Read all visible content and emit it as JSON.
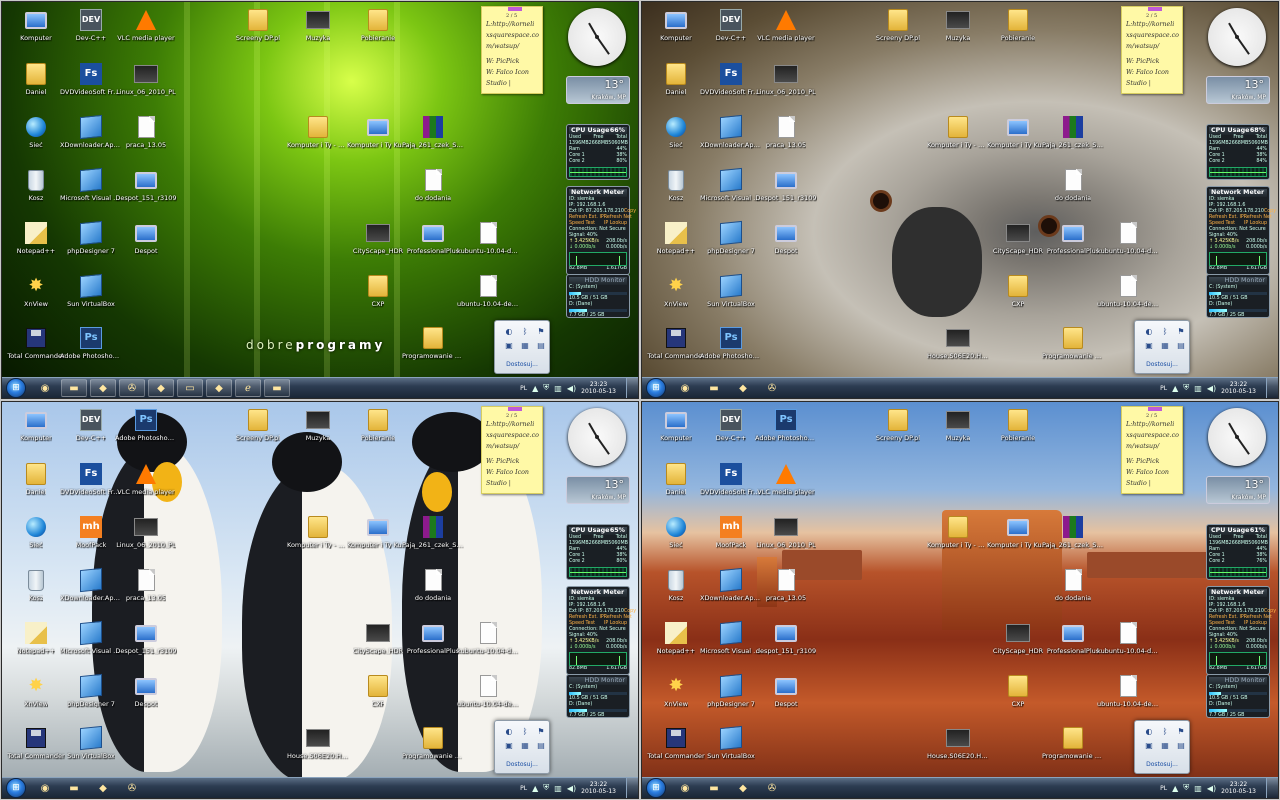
{
  "desktops": [
    {
      "wallpaper": "green",
      "clock_time": "23:23",
      "brand": [
        "dobre",
        "programy"
      ],
      "icons": [
        {
          "label": "Komputer",
          "kind": "pc"
        },
        {
          "label": "Dev-C++",
          "kind": "dev"
        },
        {
          "label": "VLC media player",
          "kind": "vlc"
        },
        {
          "label": "Screeny DP.pl",
          "kind": "folder"
        },
        {
          "label": "Muzyka",
          "kind": "thumb"
        },
        {
          "label": "Pobieranie",
          "kind": "folder"
        },
        {
          "label": "Daniel",
          "kind": "folder"
        },
        {
          "label": "DVDVideoSoft Free Studio",
          "kind": "fs"
        },
        {
          "label": "Linux_06_2010_PL",
          "kind": "thumb"
        },
        {
          "label": "Sieć",
          "kind": "globe"
        },
        {
          "label": "XDownloader.App...",
          "kind": "box"
        },
        {
          "label": "praca_13.05",
          "kind": "doc"
        },
        {
          "label": "Komputer i Ty - Multimedialny Ku...",
          "kind": "folder"
        },
        {
          "label": "Komputer i Ty Kurs PHP",
          "kind": "pc"
        },
        {
          "label": "Pają_261_czek_S_4_...",
          "kind": "rar"
        },
        {
          "label": "Kosz",
          "kind": "bin"
        },
        {
          "label": "Microsoft Visual C++ 2010 Express",
          "kind": "box"
        },
        {
          "label": "Despot_151_r3109",
          "kind": "pc"
        },
        {
          "label": "do dodania",
          "kind": "doc"
        },
        {
          "label": "Notepad++",
          "kind": "pencil"
        },
        {
          "label": "phpDesigner 7",
          "kind": "box"
        },
        {
          "label": "Despot",
          "kind": "pc"
        },
        {
          "label": "CityScape_HDR",
          "kind": "thumb"
        },
        {
          "label": "ProfessionalPlus",
          "kind": "pc"
        },
        {
          "label": "kubuntu-10.04-des...",
          "kind": "doc"
        },
        {
          "label": "XnView",
          "kind": "star"
        },
        {
          "label": "Sun VirtualBox",
          "kind": "box"
        },
        {
          "label": "CXP",
          "kind": "folder"
        },
        {
          "label": "ubuntu-10.04-desk...",
          "kind": "doc"
        },
        {
          "label": "Total Commander",
          "kind": "floppy"
        },
        {
          "label": "Adobe Photoshop CS4 (64 Bit)",
          "kind": "ps"
        },
        {
          "label": "Programowanie C++",
          "kind": "folder"
        }
      ],
      "cpu": {
        "title": "CPU Usage",
        "percent": "66%",
        "used": "1396MB",
        "free": "2668MB",
        "total": "5060MB",
        "ram": "44%",
        "core1": "38%",
        "core2": "80%"
      },
      "date": "2010-05-13"
    },
    {
      "wallpaper": "koala",
      "clock_time": "23:22",
      "icons": [
        {
          "label": "Komputer",
          "kind": "pc"
        },
        {
          "label": "Dev-C++",
          "kind": "dev"
        },
        {
          "label": "VLC media player",
          "kind": "vlc"
        },
        {
          "label": "Screeny DP.pl",
          "kind": "folder"
        },
        {
          "label": "Muzyka",
          "kind": "thumb"
        },
        {
          "label": "Pobieranie",
          "kind": "folder"
        },
        {
          "label": "Daniel",
          "kind": "folder"
        },
        {
          "label": "DVDVideoSoft Free Studio",
          "kind": "fs"
        },
        {
          "label": "Linux_06_2010_PL",
          "kind": "thumb"
        },
        {
          "label": "Sieć",
          "kind": "globe"
        },
        {
          "label": "XDownloader.App...",
          "kind": "box"
        },
        {
          "label": "praca_13.05",
          "kind": "doc"
        },
        {
          "label": "Komputer i Ty - Multimedialny Ku...",
          "kind": "folder"
        },
        {
          "label": "Komputer i Ty Kurs PHP",
          "kind": "pc"
        },
        {
          "label": "Pają_261_czek_S_4_...",
          "kind": "rar"
        },
        {
          "label": "Kosz",
          "kind": "bin"
        },
        {
          "label": "Microsoft Visual C++ 2010 Express",
          "kind": "box"
        },
        {
          "label": "Despot_151_r3109",
          "kind": "pc"
        },
        {
          "label": "do dodania",
          "kind": "doc"
        },
        {
          "label": "Notepad++",
          "kind": "pencil"
        },
        {
          "label": "phpDesigner 7",
          "kind": "box"
        },
        {
          "label": "Despot",
          "kind": "pc"
        },
        {
          "label": "CityScape_HDR",
          "kind": "thumb"
        },
        {
          "label": "ProfessionalPlus",
          "kind": "pc"
        },
        {
          "label": "kubuntu-10.04-des...",
          "kind": "doc"
        },
        {
          "label": "XnView",
          "kind": "star"
        },
        {
          "label": "Sun VirtualBox",
          "kind": "box"
        },
        {
          "label": "CXP",
          "kind": "folder"
        },
        {
          "label": "ubuntu-10.04-desk...",
          "kind": "doc"
        },
        {
          "label": "Total Commander",
          "kind": "floppy"
        },
        {
          "label": "Adobe Photoshop CS4 (64 Bit)",
          "kind": "ps"
        },
        {
          "label": "House.S06E20.HDT...",
          "kind": "thumb"
        },
        {
          "label": "Programowanie C++",
          "kind": "folder"
        }
      ],
      "cpu": {
        "title": "CPU Usage",
        "percent": "68%",
        "used": "1396MB",
        "free": "2668MB",
        "total": "5060MB",
        "ram": "44%",
        "core1": "38%",
        "core2": "84%"
      },
      "date": "2010-05-13"
    },
    {
      "wallpaper": "penguins",
      "clock_time": "23:22",
      "icons": [
        {
          "label": "Komputer",
          "kind": "pc"
        },
        {
          "label": "Dev-C++",
          "kind": "dev"
        },
        {
          "label": "Adobe Photoshop CS4 (64 Bit)",
          "kind": "ps"
        },
        {
          "label": "Screeny DP.pl",
          "kind": "folder"
        },
        {
          "label": "Muzyka",
          "kind": "thumb"
        },
        {
          "label": "Pobieranie",
          "kind": "folder"
        },
        {
          "label": "Daniel",
          "kind": "folder"
        },
        {
          "label": "DVDVideoSoft Free Studio",
          "kind": "fs"
        },
        {
          "label": "VLC media player",
          "kind": "vlc"
        },
        {
          "label": "Sieć",
          "kind": "globe"
        },
        {
          "label": "MoofPack",
          "kind": "mh"
        },
        {
          "label": "Linux_06_2010_PL",
          "kind": "thumb"
        },
        {
          "label": "Komputer i Ty - Multimedialny Ku...",
          "kind": "folder"
        },
        {
          "label": "Komputer i Ty Kurs PHP",
          "kind": "pc"
        },
        {
          "label": "Pają_261_czek_S_4_...",
          "kind": "rar"
        },
        {
          "label": "Kosz",
          "kind": "bin"
        },
        {
          "label": "XDownloader.App...",
          "kind": "box"
        },
        {
          "label": "praca_13.05",
          "kind": "doc"
        },
        {
          "label": "do dodania",
          "kind": "doc"
        },
        {
          "label": "Notepad++",
          "kind": "pencil"
        },
        {
          "label": "Microsoft Visual C++ 2010 Express",
          "kind": "box"
        },
        {
          "label": "Despot_151_r3109",
          "kind": "pc"
        },
        {
          "label": "CityScape_HDR",
          "kind": "thumb"
        },
        {
          "label": "ProfessionalPlus",
          "kind": "pc"
        },
        {
          "label": "kubuntu-10.04-des...",
          "kind": "doc"
        },
        {
          "label": "XnView",
          "kind": "star"
        },
        {
          "label": "phpDesigner 7",
          "kind": "box"
        },
        {
          "label": "Despot",
          "kind": "pc"
        },
        {
          "label": "CXP",
          "kind": "folder"
        },
        {
          "label": "ubuntu-10.04-desk...",
          "kind": "doc"
        },
        {
          "label": "Total Commander",
          "kind": "floppy"
        },
        {
          "label": "Sun VirtualBox",
          "kind": "box"
        },
        {
          "label": "House.S06E20.HDT...",
          "kind": "thumb"
        },
        {
          "label": "Programowanie C++",
          "kind": "folder"
        }
      ],
      "cpu": {
        "title": "CPU Usage",
        "percent": "65%",
        "used": "1396MB",
        "free": "2668MB",
        "total": "5060MB",
        "ram": "44%",
        "core1": "38%",
        "core2": "80%"
      },
      "date": "2010-05-13"
    },
    {
      "wallpaper": "desert",
      "clock_time": "23:22",
      "icons": [
        {
          "label": "Komputer",
          "kind": "pc"
        },
        {
          "label": "Dev-C++",
          "kind": "dev"
        },
        {
          "label": "Adobe Photoshop CS4 (64 Bit)",
          "kind": "ps"
        },
        {
          "label": "Screeny DP.pl",
          "kind": "folder"
        },
        {
          "label": "Muzyka",
          "kind": "thumb"
        },
        {
          "label": "Pobieranie",
          "kind": "folder"
        },
        {
          "label": "Daniel",
          "kind": "folder"
        },
        {
          "label": "DVDVideoSoft Free Studio",
          "kind": "fs"
        },
        {
          "label": "VLC media player",
          "kind": "vlc"
        },
        {
          "label": "Sieć",
          "kind": "globe"
        },
        {
          "label": "MoofPack",
          "kind": "mh"
        },
        {
          "label": "Linux_06_2010_PL",
          "kind": "thumb"
        },
        {
          "label": "Komputer i Ty - Multimedialny Ku...",
          "kind": "folder"
        },
        {
          "label": "Komputer i Ty Kurs PHP",
          "kind": "pc"
        },
        {
          "label": "Pają_261_czek_S_4_...",
          "kind": "rar"
        },
        {
          "label": "Kosz",
          "kind": "bin"
        },
        {
          "label": "XDownloader.App...",
          "kind": "box"
        },
        {
          "label": "praca_13.05",
          "kind": "doc"
        },
        {
          "label": "do dodania",
          "kind": "doc"
        },
        {
          "label": "Notepad++",
          "kind": "pencil"
        },
        {
          "label": "Microsoft Visual C++ 2010 Express",
          "kind": "box"
        },
        {
          "label": "despot_151_r3109",
          "kind": "pc"
        },
        {
          "label": "CityScape_HDR",
          "kind": "thumb"
        },
        {
          "label": "ProfessionalPlus",
          "kind": "pc"
        },
        {
          "label": "kubuntu-10.04-des...",
          "kind": "doc"
        },
        {
          "label": "XnView",
          "kind": "star"
        },
        {
          "label": "phpDesigner 7",
          "kind": "box"
        },
        {
          "label": "Despot",
          "kind": "pc"
        },
        {
          "label": "CXP",
          "kind": "folder"
        },
        {
          "label": "ubuntu-10.04-desk...",
          "kind": "doc"
        },
        {
          "label": "Total Commander",
          "kind": "floppy"
        },
        {
          "label": "Sun VirtualBox",
          "kind": "box"
        },
        {
          "label": "House.S06E20.HDT...",
          "kind": "thumb"
        },
        {
          "label": "Programowanie C++",
          "kind": "folder"
        }
      ],
      "cpu": {
        "title": "CPU Usage",
        "percent": "61%",
        "used": "1396MB",
        "free": "2668MB",
        "total": "5060MB",
        "ram": "44%",
        "core1": "38%",
        "core2": "76%"
      },
      "date": "2010-05-13"
    }
  ],
  "note": {
    "counter": "2 / 5",
    "lines": [
      "L:http://korneli",
      "xsquarespace.co",
      "m/watsup/",
      "W: PicPick",
      "W: Falco Icon",
      "Studio |"
    ]
  },
  "weather": {
    "temp": "13°",
    "location": "Kraków, MP"
  },
  "cpu_labels": {
    "used": "Used",
    "free": "Free",
    "total": "Total",
    "ram": "Ram",
    "core1": "Core 1",
    "core2": "Core 2"
  },
  "network": {
    "title": "Network Meter",
    "id": "ID: siemka",
    "ip": "IP: 192.168.1.6",
    "ext": "Ext IP: 87.205.178.210",
    "copy": "Copy",
    "refresh_ext": "Refresh Ext. IP",
    "refresh_net": "Refresh Net",
    "speed_test": "Speed Test",
    "ip_lookup": "IP Lookup",
    "connection": "Connection: Not Secure",
    "signal": "Signal: 40%",
    "up": "↑ 3.425KB/s",
    "down": "↓ 0.000b/s",
    "up2": "208.0b/s",
    "down2": "0.000b/s",
    "total1": "82.8MB",
    "total2": "1.617GB"
  },
  "hdd": {
    "title": "HDD Monitor",
    "c_label": "C: (System)",
    "c_val": "10.5 GB / 51 GB",
    "d_label": "D: (Dane)",
    "d_val": "7.7 GB / 25 GB",
    "c_fill": 0.21,
    "d_fill": 0.31
  },
  "tray_popup": {
    "link": "Dostosuj..."
  },
  "taskbar": {
    "lang": "PL"
  }
}
